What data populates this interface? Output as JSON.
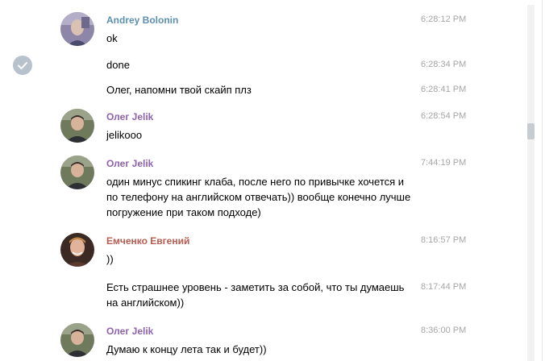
{
  "colors": {
    "name_blue": "#5c8fb0",
    "name_purple": "#8f62ad",
    "name_red": "#b85c4f",
    "time_gray": "#a6a6a6",
    "check_bg": "#b7c2cd"
  },
  "selection": {
    "icon": "checkmark-icon"
  },
  "messages": [
    {
      "sender": "Andrey Bolonin",
      "time": "6:28:12 PM",
      "text": "ok"
    },
    {
      "sender": "",
      "time": "6:28:34 PM",
      "text": "done"
    },
    {
      "sender": "",
      "time": "6:28:41 PM",
      "text": "Олег, напомни твой скайп плз"
    },
    {
      "sender": "Олег Jelik",
      "time": "6:28:54 PM",
      "text": "jelikooo"
    },
    {
      "sender": "Олег Jelik",
      "time": "7:44:19 PM",
      "text": "один минус спикинг клаба, после него по привычке хочется и по телефону на английском отвечать)) вообще конечно лучше погружение при таком подходе)"
    },
    {
      "sender": "Емченко Евгений",
      "time": "8:16:57 PM",
      "text": "))"
    },
    {
      "sender": "",
      "time": "8:17:44 PM",
      "text": "Есть страшнее уровень - заметить за собой, что ты думаешь на английском))"
    },
    {
      "sender": "Олег Jelik",
      "time": "8:36:00 PM",
      "text": "Думаю к концу лета так и будет))"
    }
  ]
}
